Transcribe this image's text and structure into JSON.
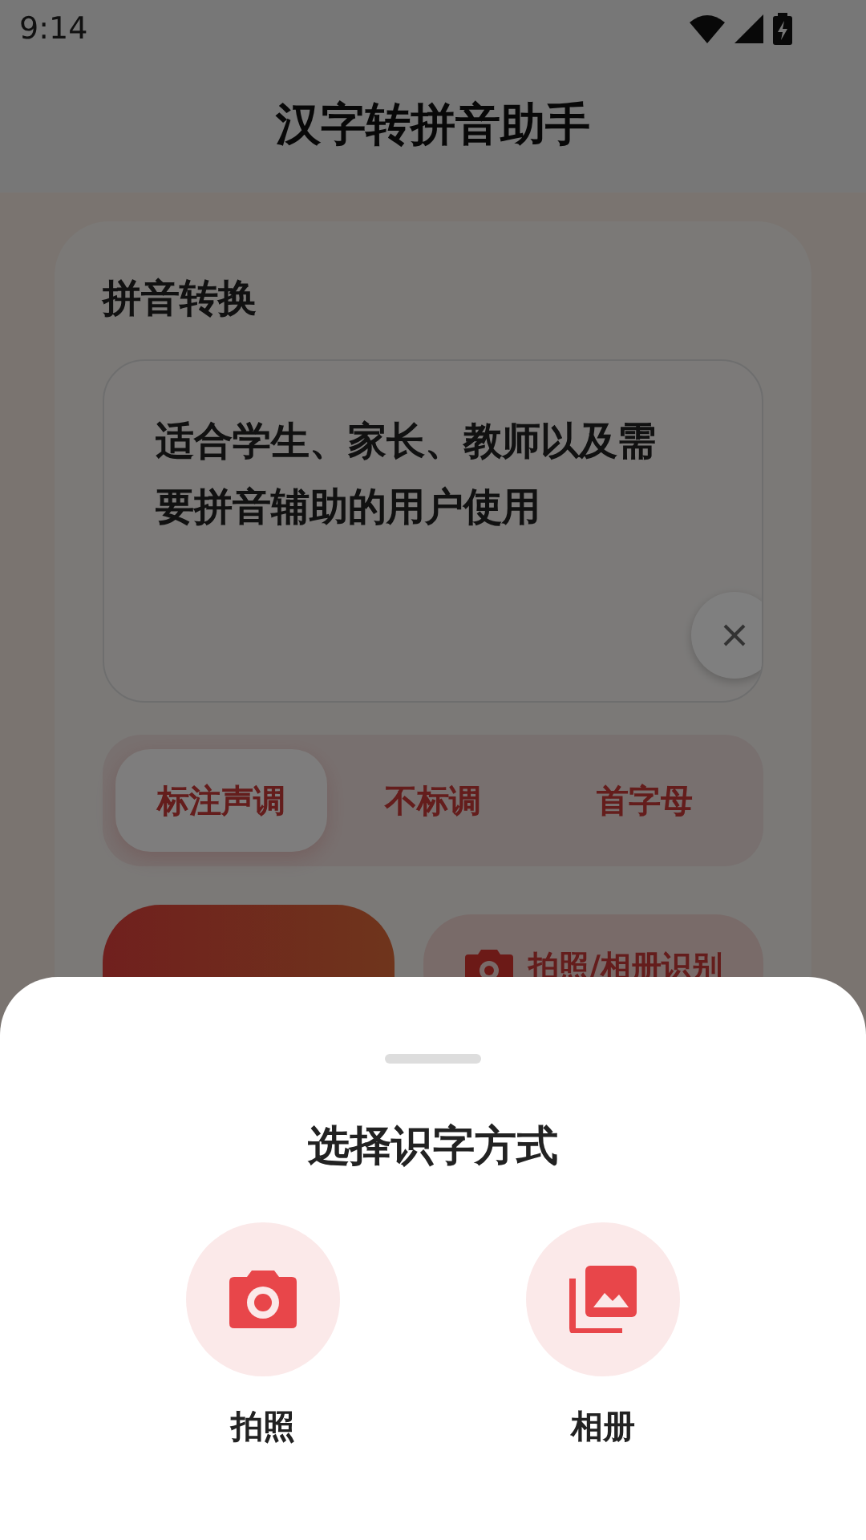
{
  "status_bar": {
    "time": "9:14"
  },
  "header": {
    "title": "汉字转拼音助手"
  },
  "card": {
    "title": "拼音转换",
    "input": {
      "value": "适合学生、家长、教师以及需要拼音辅助的用户使用"
    },
    "modes": [
      {
        "label": "标注声调",
        "selected": true
      },
      {
        "label": "不标调",
        "selected": false
      },
      {
        "label": "首字母",
        "selected": false
      }
    ],
    "ocr_button": {
      "label": "拍照/相册识别"
    }
  },
  "sheet": {
    "title": "选择识字方式",
    "options": [
      {
        "label": "拍照",
        "kind": "camera"
      },
      {
        "label": "相册",
        "kind": "album"
      }
    ]
  }
}
